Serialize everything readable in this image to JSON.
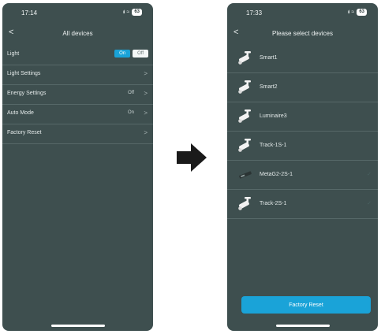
{
  "left": {
    "status": {
      "time": "17:14",
      "signal": "ııl",
      "wifi": "≈",
      "battery": "63"
    },
    "nav": {
      "title": "All devices",
      "back_glyph": "<"
    },
    "light_row": {
      "label": "Light",
      "on_label": "On",
      "off_label": "Off",
      "selected": "On"
    },
    "rows": [
      {
        "label": "Light Settings",
        "value": ""
      },
      {
        "label": "Energy Settings",
        "value": "Off"
      },
      {
        "label": "Auto Mode",
        "value": "On"
      },
      {
        "label": "Factory Reset",
        "value": ""
      }
    ],
    "chevron": ">"
  },
  "arrow": {
    "icon": "right-arrow-icon"
  },
  "right": {
    "status": {
      "time": "17:33",
      "signal": "ııl",
      "wifi": "≈",
      "battery": "63"
    },
    "nav": {
      "title": "Please select devices",
      "back_glyph": "<"
    },
    "devices": [
      {
        "label": "Smart1",
        "icon": "spotlight-icon"
      },
      {
        "label": "Smart2",
        "icon": "spotlight-icon"
      },
      {
        "label": "Luminaire3",
        "icon": "spotlight-icon"
      },
      {
        "label": "Track-1S-1",
        "icon": "spotlight-icon"
      },
      {
        "label": "MetaG2-2S-1",
        "icon": "linear-light-icon"
      },
      {
        "label": "Track-2S-1",
        "icon": "spotlight-icon"
      }
    ],
    "check_glyph": "✓",
    "button": {
      "label": "Factory Reset"
    }
  },
  "colors": {
    "screen_bg": "#3e4f4f",
    "accent": "#1aa3d8",
    "divider": "#566868",
    "text": "#e4eaea"
  }
}
